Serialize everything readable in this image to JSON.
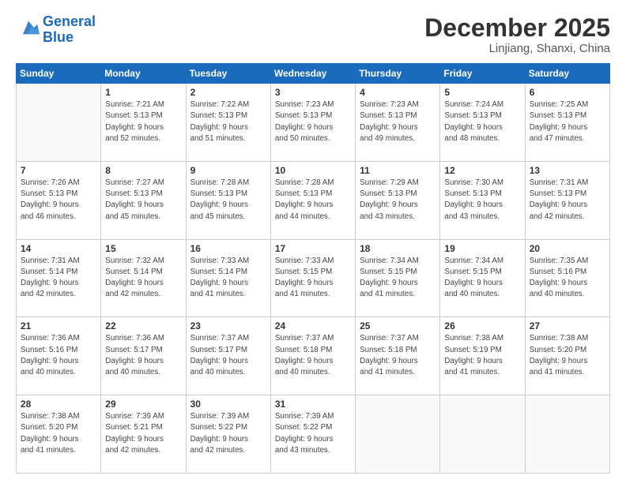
{
  "header": {
    "logo_line1": "General",
    "logo_line2": "Blue",
    "month": "December 2025",
    "location": "Linjiang, Shanxi, China"
  },
  "weekdays": [
    "Sunday",
    "Monday",
    "Tuesday",
    "Wednesday",
    "Thursday",
    "Friday",
    "Saturday"
  ],
  "weeks": [
    [
      {
        "day": "",
        "info": ""
      },
      {
        "day": "1",
        "info": "Sunrise: 7:21 AM\nSunset: 5:13 PM\nDaylight: 9 hours\nand 52 minutes."
      },
      {
        "day": "2",
        "info": "Sunrise: 7:22 AM\nSunset: 5:13 PM\nDaylight: 9 hours\nand 51 minutes."
      },
      {
        "day": "3",
        "info": "Sunrise: 7:23 AM\nSunset: 5:13 PM\nDaylight: 9 hours\nand 50 minutes."
      },
      {
        "day": "4",
        "info": "Sunrise: 7:23 AM\nSunset: 5:13 PM\nDaylight: 9 hours\nand 49 minutes."
      },
      {
        "day": "5",
        "info": "Sunrise: 7:24 AM\nSunset: 5:13 PM\nDaylight: 9 hours\nand 48 minutes."
      },
      {
        "day": "6",
        "info": "Sunrise: 7:25 AM\nSunset: 5:13 PM\nDaylight: 9 hours\nand 47 minutes."
      }
    ],
    [
      {
        "day": "7",
        "info": "Sunrise: 7:26 AM\nSunset: 5:13 PM\nDaylight: 9 hours\nand 46 minutes."
      },
      {
        "day": "8",
        "info": "Sunrise: 7:27 AM\nSunset: 5:13 PM\nDaylight: 9 hours\nand 45 minutes."
      },
      {
        "day": "9",
        "info": "Sunrise: 7:28 AM\nSunset: 5:13 PM\nDaylight: 9 hours\nand 45 minutes."
      },
      {
        "day": "10",
        "info": "Sunrise: 7:28 AM\nSunset: 5:13 PM\nDaylight: 9 hours\nand 44 minutes."
      },
      {
        "day": "11",
        "info": "Sunrise: 7:29 AM\nSunset: 5:13 PM\nDaylight: 9 hours\nand 43 minutes."
      },
      {
        "day": "12",
        "info": "Sunrise: 7:30 AM\nSunset: 5:13 PM\nDaylight: 9 hours\nand 43 minutes."
      },
      {
        "day": "13",
        "info": "Sunrise: 7:31 AM\nSunset: 5:13 PM\nDaylight: 9 hours\nand 42 minutes."
      }
    ],
    [
      {
        "day": "14",
        "info": "Sunrise: 7:31 AM\nSunset: 5:14 PM\nDaylight: 9 hours\nand 42 minutes."
      },
      {
        "day": "15",
        "info": "Sunrise: 7:32 AM\nSunset: 5:14 PM\nDaylight: 9 hours\nand 42 minutes."
      },
      {
        "day": "16",
        "info": "Sunrise: 7:33 AM\nSunset: 5:14 PM\nDaylight: 9 hours\nand 41 minutes."
      },
      {
        "day": "17",
        "info": "Sunrise: 7:33 AM\nSunset: 5:15 PM\nDaylight: 9 hours\nand 41 minutes."
      },
      {
        "day": "18",
        "info": "Sunrise: 7:34 AM\nSunset: 5:15 PM\nDaylight: 9 hours\nand 41 minutes."
      },
      {
        "day": "19",
        "info": "Sunrise: 7:34 AM\nSunset: 5:15 PM\nDaylight: 9 hours\nand 40 minutes."
      },
      {
        "day": "20",
        "info": "Sunrise: 7:35 AM\nSunset: 5:16 PM\nDaylight: 9 hours\nand 40 minutes."
      }
    ],
    [
      {
        "day": "21",
        "info": "Sunrise: 7:36 AM\nSunset: 5:16 PM\nDaylight: 9 hours\nand 40 minutes."
      },
      {
        "day": "22",
        "info": "Sunrise: 7:36 AM\nSunset: 5:17 PM\nDaylight: 9 hours\nand 40 minutes."
      },
      {
        "day": "23",
        "info": "Sunrise: 7:37 AM\nSunset: 5:17 PM\nDaylight: 9 hours\nand 40 minutes."
      },
      {
        "day": "24",
        "info": "Sunrise: 7:37 AM\nSunset: 5:18 PM\nDaylight: 9 hours\nand 40 minutes."
      },
      {
        "day": "25",
        "info": "Sunrise: 7:37 AM\nSunset: 5:18 PM\nDaylight: 9 hours\nand 41 minutes."
      },
      {
        "day": "26",
        "info": "Sunrise: 7:38 AM\nSunset: 5:19 PM\nDaylight: 9 hours\nand 41 minutes."
      },
      {
        "day": "27",
        "info": "Sunrise: 7:38 AM\nSunset: 5:20 PM\nDaylight: 9 hours\nand 41 minutes."
      }
    ],
    [
      {
        "day": "28",
        "info": "Sunrise: 7:38 AM\nSunset: 5:20 PM\nDaylight: 9 hours\nand 41 minutes."
      },
      {
        "day": "29",
        "info": "Sunrise: 7:39 AM\nSunset: 5:21 PM\nDaylight: 9 hours\nand 42 minutes."
      },
      {
        "day": "30",
        "info": "Sunrise: 7:39 AM\nSunset: 5:22 PM\nDaylight: 9 hours\nand 42 minutes."
      },
      {
        "day": "31",
        "info": "Sunrise: 7:39 AM\nSunset: 5:22 PM\nDaylight: 9 hours\nand 43 minutes."
      },
      {
        "day": "",
        "info": ""
      },
      {
        "day": "",
        "info": ""
      },
      {
        "day": "",
        "info": ""
      }
    ]
  ]
}
